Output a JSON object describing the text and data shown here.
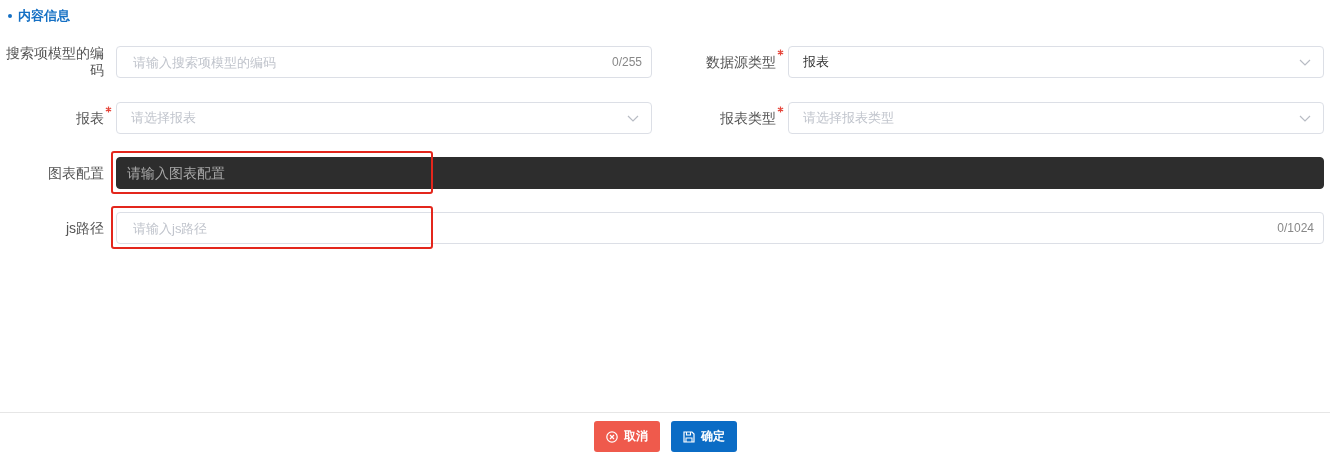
{
  "section": {
    "title": "内容信息"
  },
  "rows": [
    {
      "fields": [
        {
          "kind": "text",
          "label": "搜索项模型的编码",
          "required": false,
          "placeholder": "请输入搜索项模型的编码",
          "counter": "0/255",
          "highlighted": false
        },
        {
          "kind": "select",
          "label": "数据源类型",
          "required": true,
          "value": "报表",
          "highlighted": false
        }
      ]
    },
    {
      "fields": [
        {
          "kind": "select",
          "label": "报表",
          "required": true,
          "placeholder": "请选择报表",
          "highlighted": false
        },
        {
          "kind": "select",
          "label": "报表类型",
          "required": true,
          "placeholder": "请选择报表类型",
          "highlighted": false
        }
      ]
    },
    {
      "fields": [
        {
          "kind": "code",
          "label": "图表配置",
          "required": false,
          "placeholder": "请输入图表配置",
          "highlighted": true
        }
      ]
    },
    {
      "fields": [
        {
          "kind": "text",
          "label": "js路径",
          "required": false,
          "placeholder": "请输入js路径",
          "counter": "0/1024",
          "highlighted": true
        }
      ]
    }
  ],
  "buttons": [
    {
      "kind": "cancel",
      "label": "取消"
    },
    {
      "kind": "confirm",
      "label": "确定"
    }
  ]
}
